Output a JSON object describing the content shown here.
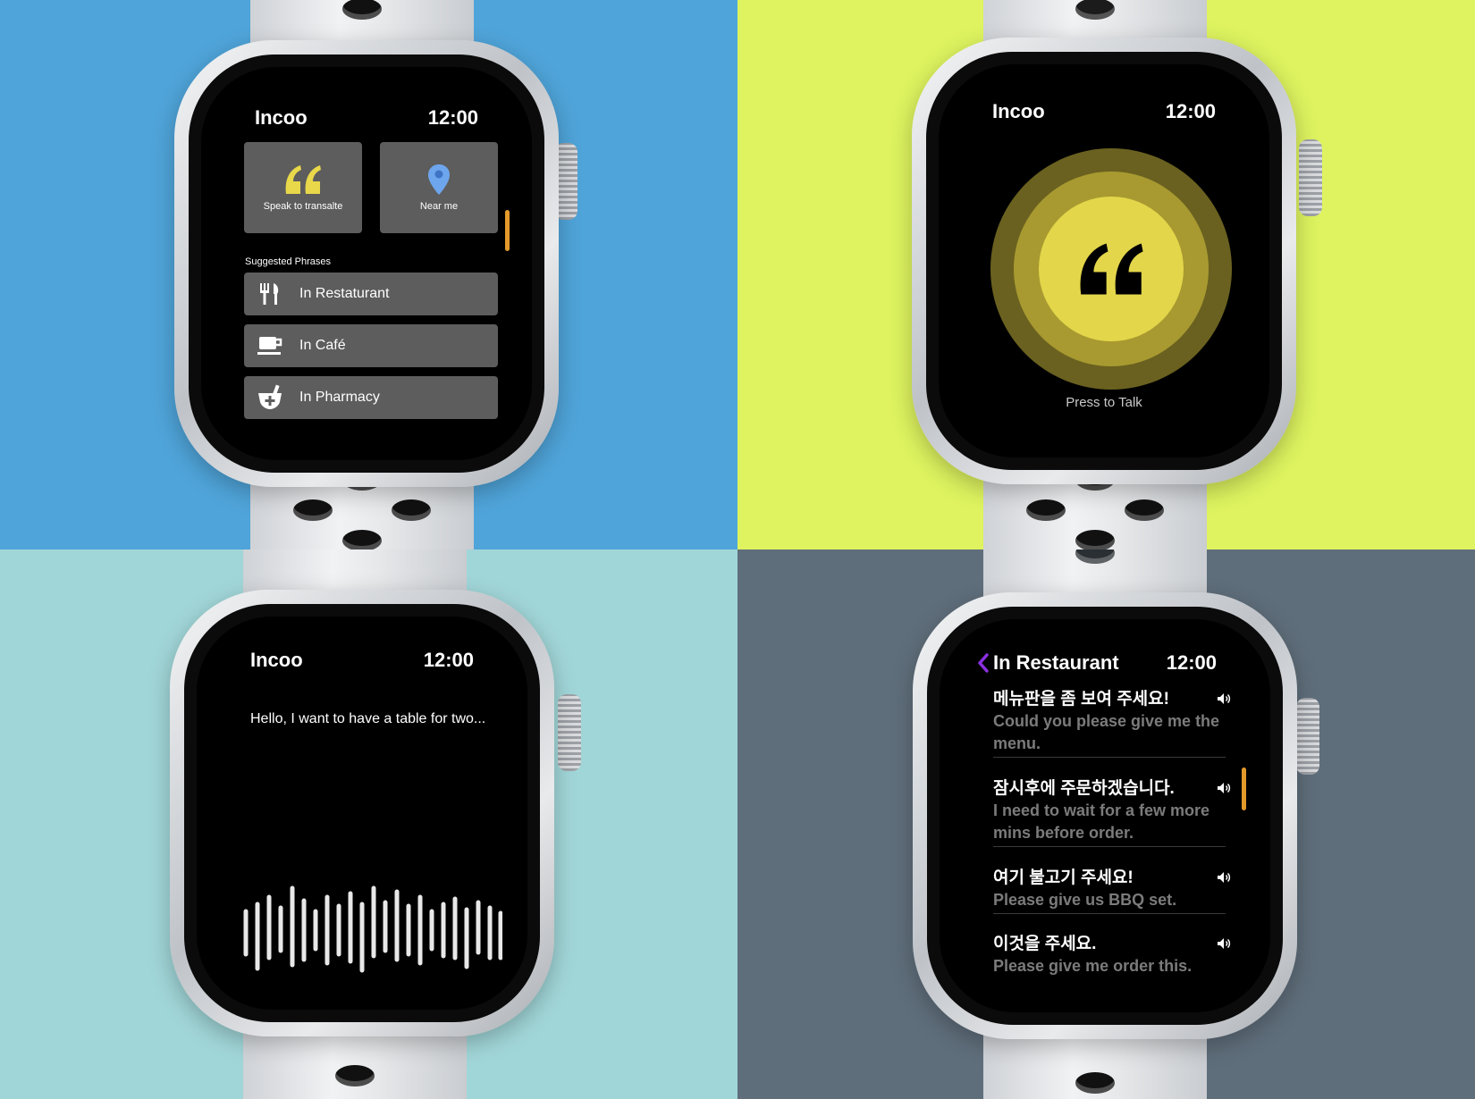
{
  "colors": {
    "q1_bg": "#4fa4d9",
    "q2_bg": "#def35f",
    "q3_bg": "#a1d6d8",
    "q4_bg": "#5f6e7b",
    "accent_orange": "#e39a2a",
    "quote_yellow": "#e8d84a",
    "back_purple": "#8b2fe0",
    "pin_blue": "#6ea6ee"
  },
  "screen1": {
    "app_name": "Incoo",
    "time": "12:00",
    "tiles": [
      {
        "label": "Speak to transalte",
        "icon": "quote-icon"
      },
      {
        "label": "Near me",
        "icon": "location-pin-icon"
      }
    ],
    "section_title": "Suggested Phrases",
    "rows": [
      {
        "label": "In Restaturant",
        "icon": "fork-knife-icon"
      },
      {
        "label": "In Café",
        "icon": "coffee-cup-icon"
      },
      {
        "label": "In Pharmacy",
        "icon": "mortar-pestle-icon"
      }
    ]
  },
  "screen2": {
    "app_name": "Incoo",
    "time": "12:00",
    "button_label": "Press to Talk"
  },
  "screen3": {
    "app_name": "Incoo",
    "time": "12:00",
    "transcript": "Hello, I want to have a table for two..."
  },
  "screen4": {
    "title": "In Restaurant",
    "time": "12:00",
    "phrases": [
      {
        "ko": "메뉴판을 좀 보여 주세요!",
        "en": "Could you please give me the menu."
      },
      {
        "ko": "잠시후에 주문하겠습니다.",
        "en": "I need to wait for a few more mins before order."
      },
      {
        "ko": "여기 불고기 주세요!",
        "en": "Please give us BBQ set."
      },
      {
        "ko": "이것을 주세요.",
        "en": "Please give me order this."
      }
    ]
  }
}
